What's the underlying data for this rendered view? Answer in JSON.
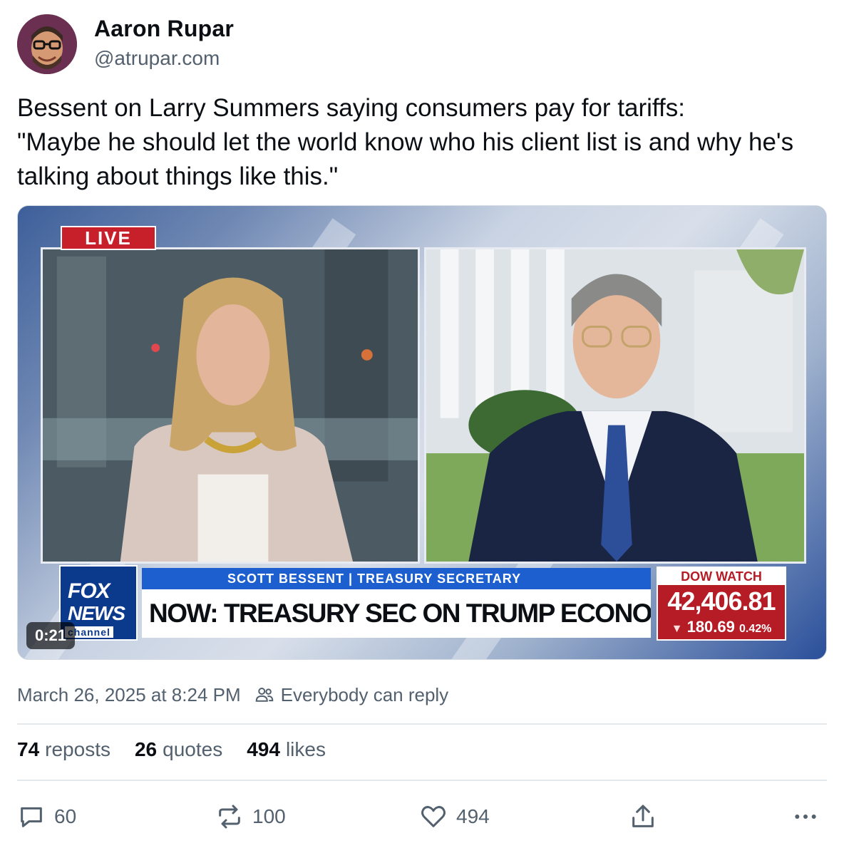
{
  "author": {
    "name": "Aaron Rupar",
    "handle": "@atrupar.com"
  },
  "post": {
    "text": "Bessent on Larry Summers saying consumers pay for tariffs:\n\"Maybe he should let the world know who his client list is and why he's talking about things like this.\""
  },
  "video": {
    "live_label": "LIVE",
    "network_logo_top": "FOX",
    "network_logo_middle": "NEWS",
    "network_logo_bottom": "channel",
    "chyron_name": "SCOTT BESSENT | TREASURY SECRETARY",
    "chyron_headline": "NOW: TREASURY SEC ON TRUMP ECONOMIC AGENDA",
    "dow_title": "DOW WATCH",
    "dow_value": "42,406.81",
    "dow_change": "180.69",
    "dow_percent": "0.42%",
    "timecode": "0:21",
    "colors": {
      "live_red": "#c8202a",
      "fox_blue": "#0b3a8c",
      "dow_red": "#b51c26"
    }
  },
  "meta": {
    "timestamp": "March 26, 2025 at 8:24 PM",
    "reply_setting": "Everybody can reply",
    "reply_icon": "people-icon"
  },
  "stats": {
    "reposts_count": "74",
    "reposts_label": "reposts",
    "quotes_count": "26",
    "quotes_label": "quotes",
    "likes_count": "494",
    "likes_label": "likes"
  },
  "actions": {
    "reply_count": "60",
    "repost_count": "100",
    "like_count": "494",
    "icons": [
      "comment-icon",
      "repost-icon",
      "heart-icon",
      "share-icon",
      "more-icon"
    ]
  },
  "theme": {
    "text_primary": "#0b0f14",
    "text_secondary": "#53606e",
    "divider": "#e3e8ec"
  }
}
